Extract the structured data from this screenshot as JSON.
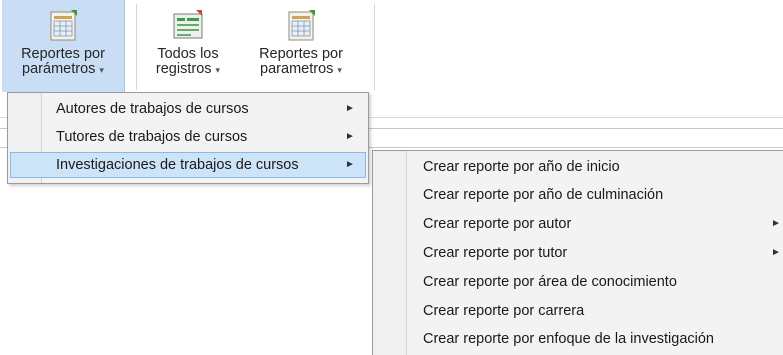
{
  "ribbon": {
    "buttons": [
      {
        "label1": "Reportes por",
        "label2": "parámetros",
        "dropdown": "▾"
      },
      {
        "label1": "Todos los",
        "label2": "registros",
        "dropdown": "▾"
      },
      {
        "label1": "Reportes por",
        "label2": "parametros",
        "dropdown": "▾"
      }
    ],
    "active_index": 0
  },
  "menu": {
    "items": [
      {
        "label": "Autores de trabajos de cursos",
        "has_submenu": true
      },
      {
        "label": "Tutores de trabajos de cursos",
        "has_submenu": true
      },
      {
        "label": "Investigaciones de trabajos de cursos",
        "has_submenu": true,
        "highlighted": true
      }
    ],
    "arrow": "►"
  },
  "submenu": {
    "items": [
      {
        "label": "Crear reporte por año de inicio"
      },
      {
        "label": "Crear reporte por año de culminación"
      },
      {
        "label": "Crear reporte por autor",
        "has_submenu": true
      },
      {
        "label": "Crear reporte por tutor",
        "has_submenu": true
      },
      {
        "label": "Crear reporte por área de conocimiento"
      },
      {
        "label": "Crear reporte por carrera"
      },
      {
        "label": "Crear reporte por enfoque de la investigación"
      }
    ],
    "arrow": "►"
  },
  "colors": {
    "active_button": "#c9def5",
    "highlight": "#cde3f8",
    "menu_bg": "#f3f3f3"
  }
}
